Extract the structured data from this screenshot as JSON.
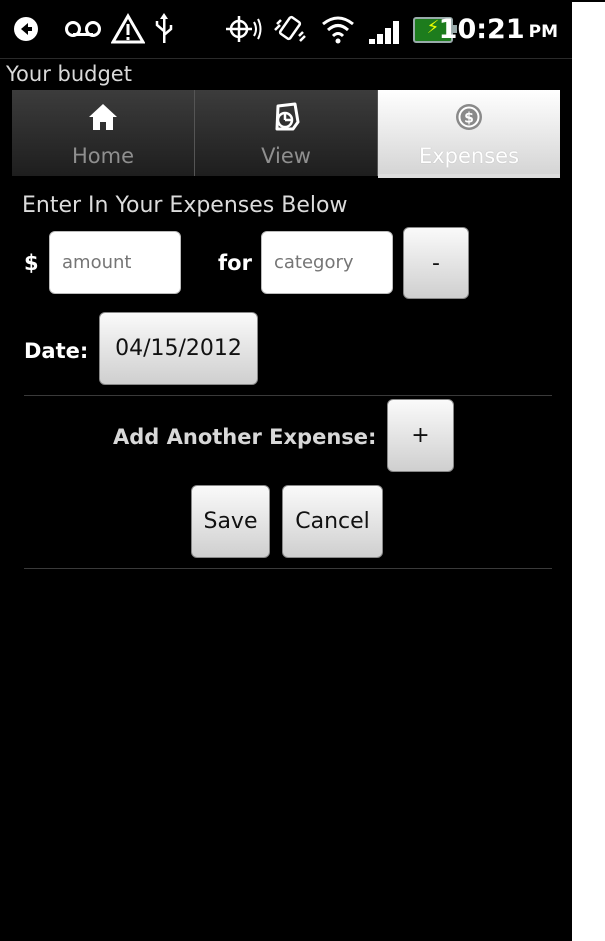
{
  "status_bar": {
    "icons": [
      "back-arrow-icon",
      "voicemail-icon",
      "alert-icon",
      "usb-icon",
      "gps-icon",
      "vibrate-icon",
      "wifi-icon",
      "signal-icon",
      "battery-icon"
    ],
    "time": "10:21",
    "ampm": "PM"
  },
  "app": {
    "title": "Your budget"
  },
  "tabs": [
    {
      "label": "Home",
      "icon": "home-icon",
      "selected": false
    },
    {
      "label": "View",
      "icon": "pie-chart-icon",
      "selected": false
    },
    {
      "label": "Expenses",
      "icon": "dollar-coin-icon",
      "selected": true
    }
  ],
  "form": {
    "prompt": "Enter In Your Expenses Below",
    "currency_symbol": "$",
    "amount_placeholder": "amount",
    "for_label": "for",
    "category_placeholder": "category",
    "remove_label": "-",
    "date_label": "Date:",
    "date_value": "04/15/2012",
    "add_label": "Add Another Expense:",
    "add_button": "+",
    "save_label": "Save",
    "cancel_label": "Cancel"
  },
  "colors": {
    "background": "#000000",
    "selected_tab": "#ffffff",
    "battery_fill": "#1d7c1d"
  }
}
